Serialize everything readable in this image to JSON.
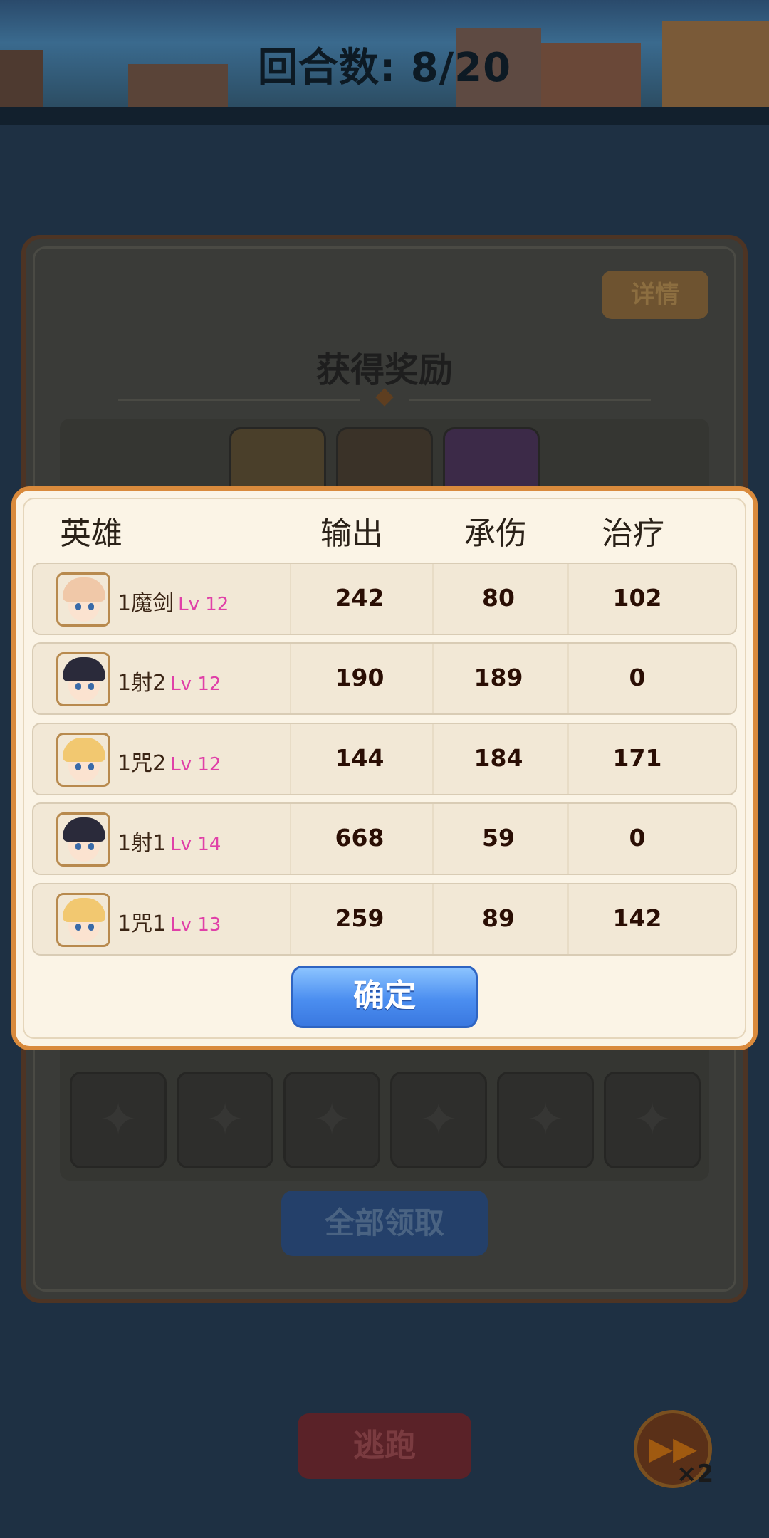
{
  "header": {
    "round_count": "回合数: 8/20"
  },
  "reward_panel": {
    "detail_label": "详情",
    "title": "获得奖励",
    "claim_all_label": "全部领取"
  },
  "battle_controls": {
    "escape_label": "逃跑",
    "speed_label": "×2"
  },
  "stats_modal": {
    "columns": {
      "hero": "英雄",
      "output": "输出",
      "damage_taken": "承伤",
      "healing": "治疗"
    },
    "rows": [
      {
        "name": "1魔剑",
        "level": "Lv 12",
        "output": "242",
        "damage_taken": "80",
        "healing": "102",
        "hair_color": "#f0c8a8"
      },
      {
        "name": "1射2",
        "level": "Lv 12",
        "output": "190",
        "damage_taken": "189",
        "healing": "0",
        "hair_color": "#2a2a3a"
      },
      {
        "name": "1咒2",
        "level": "Lv 12",
        "output": "144",
        "damage_taken": "184",
        "healing": "171",
        "hair_color": "#f2c870"
      },
      {
        "name": "1射1",
        "level": "Lv 14",
        "output": "668",
        "damage_taken": "59",
        "healing": "0",
        "hair_color": "#2a2a3a"
      },
      {
        "name": "1咒1",
        "level": "Lv 13",
        "output": "259",
        "damage_taken": "89",
        "healing": "142",
        "hair_color": "#f2c870"
      }
    ],
    "confirm_label": "确定"
  },
  "colors": {
    "accent": "#d98a3c",
    "level": "#e040a8",
    "confirm": "#4b8ef0"
  }
}
